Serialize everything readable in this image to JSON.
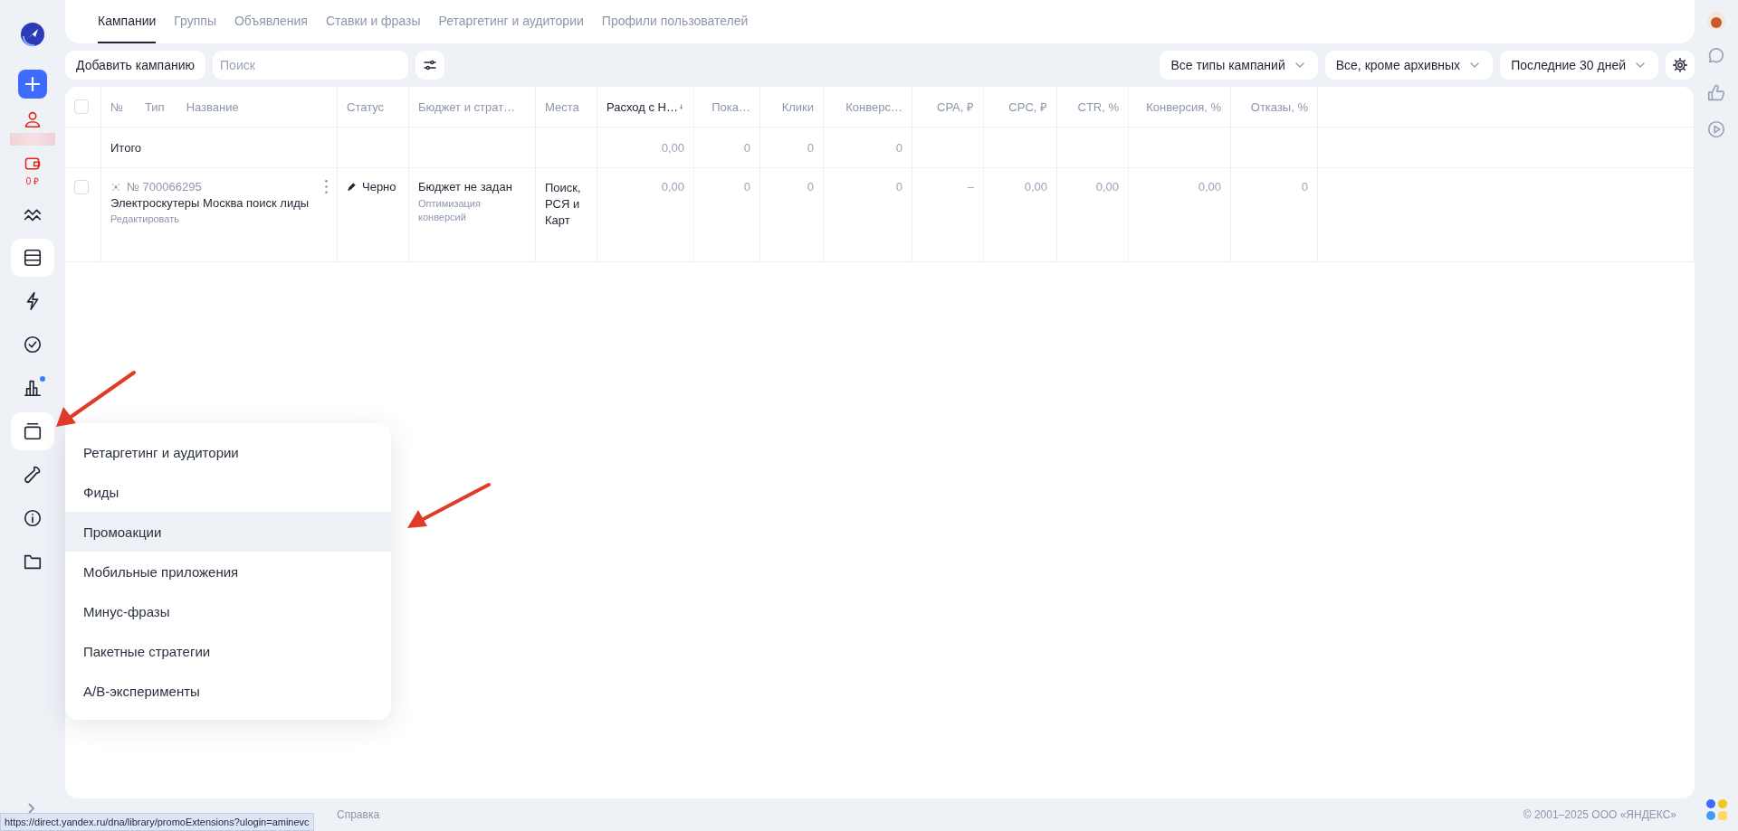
{
  "sidebar": {
    "items": [
      {
        "kind": "add",
        "selected": false
      },
      {
        "kind": "user",
        "selected": false
      },
      {
        "kind": "wallet",
        "label": "0 ₽",
        "selected": false
      },
      {
        "kind": "waves",
        "selected": false
      },
      {
        "kind": "table",
        "selected": true
      },
      {
        "kind": "bolt",
        "selected": false
      },
      {
        "kind": "check",
        "selected": false
      },
      {
        "kind": "chart",
        "badge": true,
        "selected": false
      },
      {
        "kind": "library",
        "selected": true
      },
      {
        "kind": "wrench",
        "selected": false
      },
      {
        "kind": "info",
        "selected": false
      },
      {
        "kind": "folder",
        "selected": false
      }
    ]
  },
  "tabs": [
    {
      "label": "Кампании",
      "selected": true
    },
    {
      "label": "Группы",
      "selected": false
    },
    {
      "label": "Объявления",
      "selected": false
    },
    {
      "label": "Ставки и фразы",
      "selected": false
    },
    {
      "label": "Ретаргетинг и аудитории",
      "selected": false
    },
    {
      "label": "Профили пользователей",
      "selected": false
    }
  ],
  "toolbar": {
    "add_button": "Добавить кампанию",
    "search": {
      "placeholder": "Поиск"
    },
    "filters": [
      "Все типы кампаний",
      "Все, кроме архивных",
      "Последние 30 дней"
    ]
  },
  "table": {
    "select_all": {
      "checked": false
    },
    "name_headers": [
      "№",
      "Тип",
      "Название"
    ],
    "columns": [
      {
        "label": "Статус",
        "sorted": false
      },
      {
        "label": "Бюджет и страт…",
        "sorted": false
      },
      {
        "label": "Места",
        "sorted": false
      },
      {
        "label": "Расход с Н…",
        "sorted": true
      },
      {
        "label": "Пока…",
        "sorted": false
      },
      {
        "label": "Клики",
        "sorted": false
      },
      {
        "label": "Конверс…",
        "sorted": false
      },
      {
        "label": "CPA, ₽",
        "sorted": false
      },
      {
        "label": "CPC, ₽",
        "sorted": false
      },
      {
        "label": "CTR, %",
        "sorted": false
      },
      {
        "label": "Конверсия, %",
        "sorted": false
      },
      {
        "label": "Отказы, %",
        "sorted": false
      }
    ],
    "total": {
      "label": "Итого",
      "values": [
        "0,00",
        "0",
        "0",
        "0"
      ]
    },
    "rows": [
      {
        "checked": false,
        "number": "№ 700066295",
        "name": "Электроскутеры Москва поиск лиды",
        "edit_link": "Редактировать",
        "status": "Черно",
        "budget": "Бюджет не задан",
        "strategy": "Оптимизация конверсий",
        "places": "Поиск, РСЯ и Карт",
        "values": [
          "0,00",
          "0",
          "0",
          "0",
          "–",
          "0,00",
          "0,00",
          "0,00",
          "0"
        ]
      }
    ]
  },
  "menu": {
    "items": [
      {
        "label": "Ретаргетинг и аудитории",
        "hovered": false
      },
      {
        "label": "Фиды",
        "hovered": false
      },
      {
        "label": "Промоакции",
        "hovered": true
      },
      {
        "label": "Мобильные приложения",
        "hovered": false
      },
      {
        "label": "Минус-фразы",
        "hovered": false
      },
      {
        "label": "Пакетные стратегии",
        "hovered": false
      },
      {
        "label": "A/B-эксперименты",
        "hovered": false
      }
    ]
  },
  "footer": {
    "links": [
      "Справка"
    ],
    "copyright": "© 2001–2025 ООО «ЯНДЕКС»"
  },
  "status_url": "https://direct.yandex.ru/dna/library/promoExtensions?ulogin=aminevc"
}
